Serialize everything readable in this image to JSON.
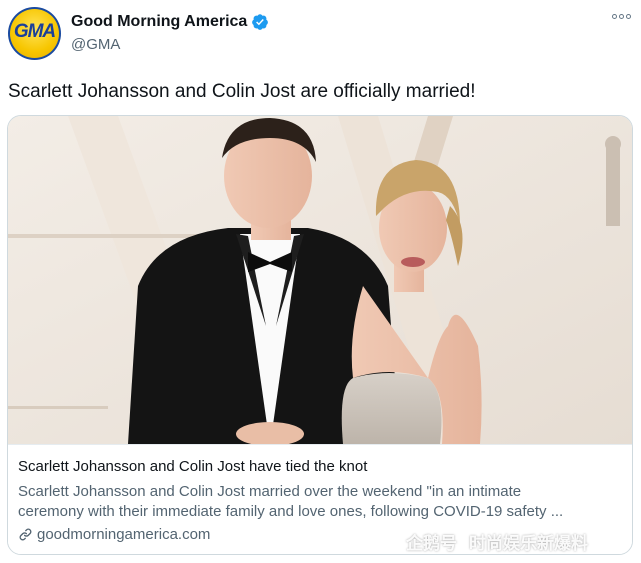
{
  "account": {
    "display_name": "Good Morning America",
    "handle": "@GMA",
    "avatar_text": "GMA",
    "verified": true
  },
  "tweet": {
    "text": "Scarlett Johansson and Colin Jost are officially married!"
  },
  "card": {
    "title": "Scarlett Johansson and Colin Jost have tied the knot",
    "description_line1": "Scarlett Johansson and Colin Jost married over the weekend \"in an intimate",
    "description_line2": "ceremony with their immediate family and love ones, following COVID-19 safety ...",
    "link": "goodmorningamerica.com"
  },
  "watermark": {
    "platform": "企鹅号",
    "channel": "时尚娱乐新爆料"
  },
  "colors": {
    "text_primary": "#0f1419",
    "text_secondary": "#536471",
    "verified_blue": "#1d9bf0",
    "border": "#cfd9de"
  },
  "icons": [
    "verified-badge-icon",
    "more-options-icon",
    "link-icon",
    "penguin-logo-icon"
  ]
}
